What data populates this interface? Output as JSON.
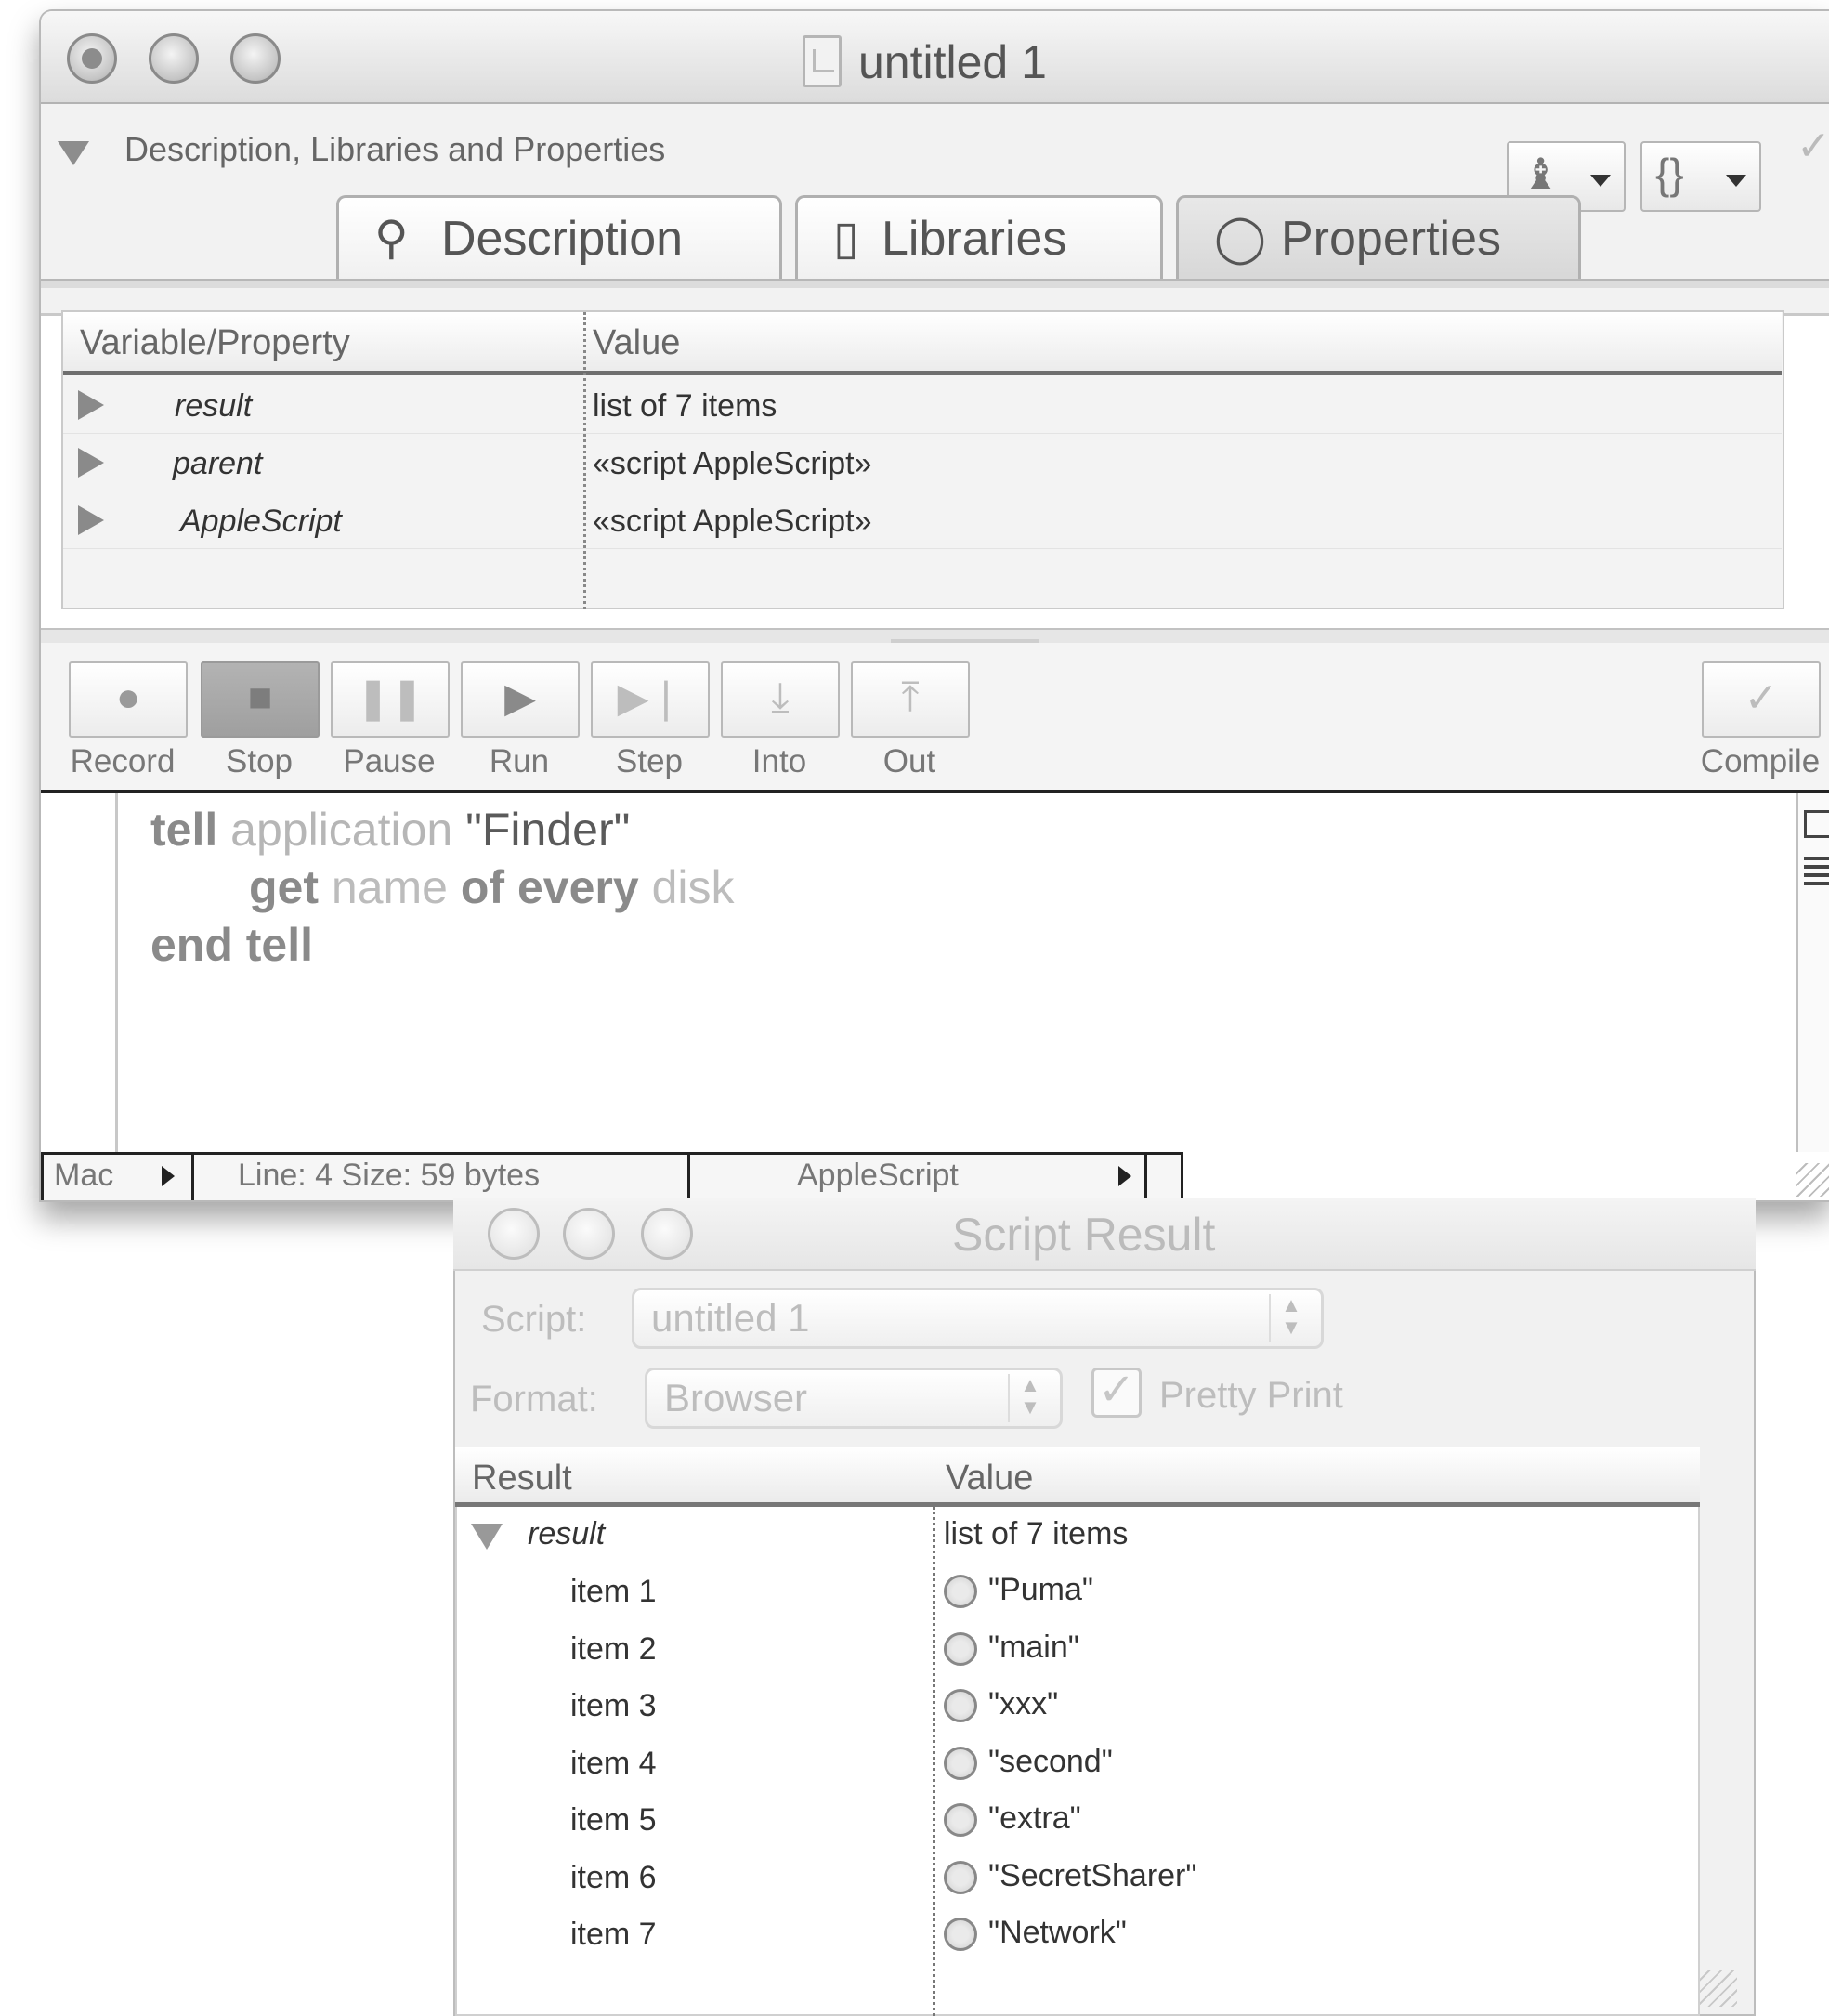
{
  "main_window": {
    "title": "untitled 1",
    "drawer": {
      "label": "Description, Libraries and Properties",
      "tabs": [
        {
          "label": "Description",
          "icon": "magnifier-icon"
        },
        {
          "label": "Libraries",
          "icon": "book-icon"
        },
        {
          "label": "Properties",
          "icon": "circle-icon",
          "active": true
        }
      ],
      "table": {
        "headers": [
          "Variable/Property",
          "Value"
        ],
        "rows": [
          {
            "name": "result",
            "value": "list of 7 items"
          },
          {
            "name": "parent",
            "value": "«script AppleScript»"
          },
          {
            "name": "AppleScript",
            "value": "«script AppleScript»"
          }
        ]
      }
    },
    "toolbar": {
      "buttons": [
        {
          "label": "Record"
        },
        {
          "label": "Stop"
        },
        {
          "label": "Pause"
        },
        {
          "label": "Run"
        },
        {
          "label": "Step"
        },
        {
          "label": "Into"
        },
        {
          "label": "Out"
        }
      ],
      "compile_label": "Compile"
    },
    "code": {
      "line1": {
        "kw": "tell",
        "app": "application",
        "str": "\"Finder\""
      },
      "line2": {
        "kw1": "get",
        "w1": "name",
        "kw2": "of",
        "kw3": "every",
        "w2": "disk"
      },
      "line3": {
        "kw": "end tell"
      }
    },
    "status": {
      "line_ending": "Mac",
      "line_info": "Line: 4  Size: 59 bytes",
      "language": "AppleScript"
    }
  },
  "result_window": {
    "title": "Script Result",
    "script_label": "Script:",
    "script_value": "untitled 1",
    "format_label": "Format:",
    "format_value": "Browser",
    "pretty_print_label": "Pretty Print",
    "pretty_print_checked": true,
    "table": {
      "headers": [
        "Result",
        "Value"
      ],
      "root": {
        "name": "result",
        "value": "list of 7 items"
      },
      "items": [
        {
          "name": "item 1",
          "value": "\"Puma\""
        },
        {
          "name": "item 2",
          "value": "\"main\""
        },
        {
          "name": "item 3",
          "value": "\"xxx\""
        },
        {
          "name": "item 4",
          "value": "\"second\""
        },
        {
          "name": "item 5",
          "value": "\"extra\""
        },
        {
          "name": "item 6",
          "value": "\"SecretSharer\""
        },
        {
          "name": "item 7",
          "value": "\"Network\""
        }
      ]
    }
  }
}
